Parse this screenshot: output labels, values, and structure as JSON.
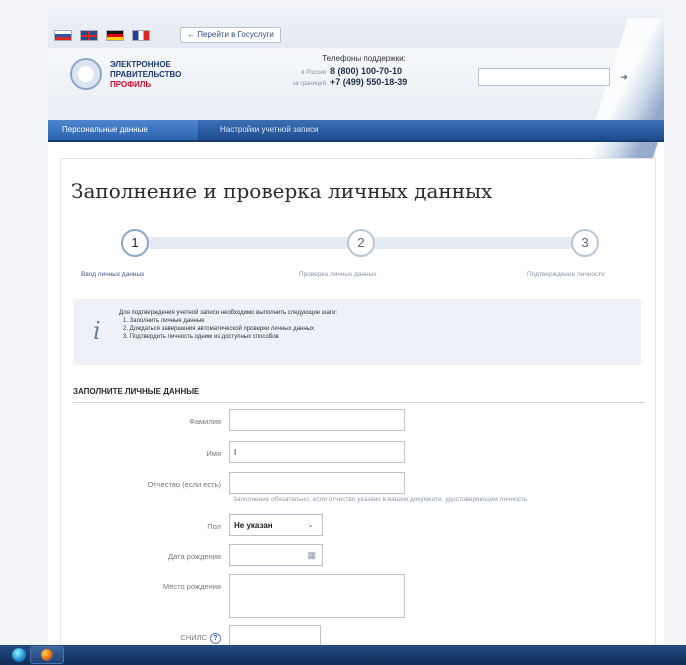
{
  "topbar": {
    "languages": [
      "Русский",
      "English",
      "Deutsch",
      "Français"
    ],
    "goto_label": "← Перейти в Госуслуги"
  },
  "header": {
    "logo_line1": "ЭЛЕКТРОННОЕ",
    "logo_line2": "ПРАВИТЕЛЬСТВО",
    "logo_line3": "ПРОФИЛЬ",
    "phones_title": "Телефоны поддержки:",
    "phone1_label": "в России",
    "phone1": "8 (800) 100-70-10",
    "phone2_label": "за границей",
    "phone2": "+7 (499) 550-18-39",
    "search_placeholder": ""
  },
  "nav": {
    "tab_personal": "Персональные данные",
    "tab_settings": "Настройки учетной записи"
  },
  "main": {
    "title": "Заполнение и проверка личных данных",
    "steps": [
      {
        "num": "1",
        "label": "Ввод личных данных"
      },
      {
        "num": "2",
        "label": "Проверка личных данных"
      },
      {
        "num": "3",
        "label": "Подтверждение личности"
      }
    ],
    "info": {
      "icon": "i",
      "intro": "Для подтверждения учетной записи необходимо выполнить следующие шаги:",
      "items": [
        "1. Заполнить личные данные",
        "2. Дождаться завершения автоматической проверки личных данных",
        "3. Подтвердить личность одним из доступных способов"
      ]
    },
    "section_title": "ЗАПОЛНИТЕ ЛИЧНЫЕ ДАННЫЕ",
    "fields": {
      "surname_label": "Фамилия",
      "surname_value": "",
      "name_label": "Имя",
      "name_value": "I",
      "patronymic_label": "Отчество (если есть)",
      "patronymic_value": "",
      "patronymic_hint": "Заполнение обязательно, если отчество указано в вашем документе, удостоверяющем личность",
      "gender_label": "Пол",
      "gender_value": "Не указан",
      "birthdate_label": "Дата рождения",
      "birthdate_value": "",
      "birthplace_label": "Место рождения",
      "birthplace_value": "",
      "snils_label": "СНИЛС",
      "snils_value": ""
    }
  },
  "colors": {
    "nav_blue": "#1f4d8e",
    "nav_active": "#2b63ad",
    "info_bg": "#eef2f8"
  }
}
